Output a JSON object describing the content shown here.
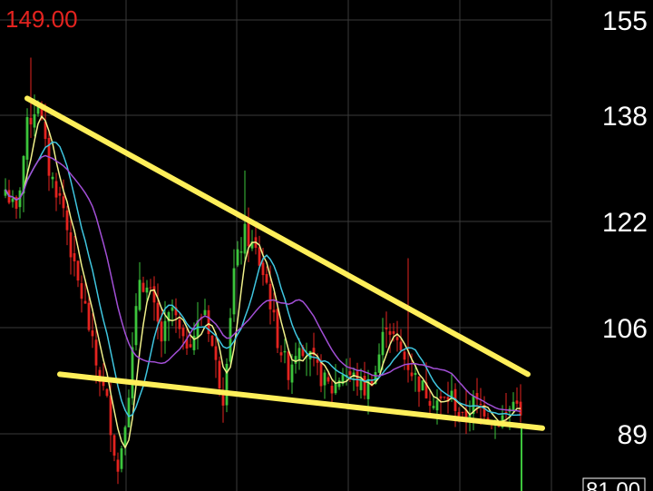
{
  "chart_data": {
    "type": "candlestick",
    "high_label": "149.00",
    "low_label": "81.00",
    "y_ticks": [
      155,
      138,
      122,
      106,
      89
    ],
    "ylim": [
      81,
      155
    ],
    "grid": true,
    "colors": {
      "background": "#000000",
      "grid": "#3a3a3a",
      "up": "#3cc43c",
      "down": "#e3231f",
      "ma_short": "#f0f08a",
      "ma_mid": "#3fc6e0",
      "ma_long": "#a24fd6",
      "trendline": "#ffef5a",
      "high_label": "#e3231f",
      "axis_text": "#ffffff"
    },
    "anchors": [
      [
        0,
        128
      ],
      [
        3,
        124
      ],
      [
        6,
        138
      ],
      [
        9,
        142
      ],
      [
        12,
        131
      ],
      [
        16,
        125
      ],
      [
        19,
        115
      ],
      [
        22,
        109
      ],
      [
        25,
        100
      ],
      [
        28,
        94
      ],
      [
        31,
        83
      ],
      [
        34,
        96
      ],
      [
        37,
        114
      ],
      [
        40,
        111
      ],
      [
        43,
        104
      ],
      [
        46,
        109
      ],
      [
        49,
        103
      ],
      [
        52,
        105
      ],
      [
        55,
        109
      ],
      [
        58,
        100
      ],
      [
        60,
        95
      ],
      [
        63,
        115
      ],
      [
        66,
        121
      ],
      [
        69,
        118
      ],
      [
        72,
        113
      ],
      [
        75,
        104
      ],
      [
        78,
        99
      ],
      [
        81,
        104
      ],
      [
        84,
        101
      ],
      [
        87,
        98
      ],
      [
        90,
        96
      ],
      [
        93,
        99
      ],
      [
        96,
        98
      ],
      [
        99,
        96
      ],
      [
        102,
        99
      ],
      [
        105,
        107
      ],
      [
        108,
        103
      ],
      [
        111,
        100
      ],
      [
        114,
        97
      ],
      [
        117,
        95
      ],
      [
        120,
        94
      ],
      [
        123,
        95
      ],
      [
        126,
        91
      ],
      [
        129,
        94
      ],
      [
        132,
        93
      ],
      [
        135,
        91
      ],
      [
        138,
        92
      ],
      [
        141,
        95
      ],
      [
        142,
        91
      ]
    ],
    "moving_averages": [
      "ma_short",
      "ma_mid",
      "ma_long"
    ],
    "trendlines": [
      {
        "name": "resistance",
        "from": [
          6,
          142.5
        ],
        "to": [
          144,
          98.5
        ]
      },
      {
        "name": "support",
        "from": [
          15,
          98.5
        ],
        "to": [
          148,
          89.9
        ]
      }
    ]
  }
}
